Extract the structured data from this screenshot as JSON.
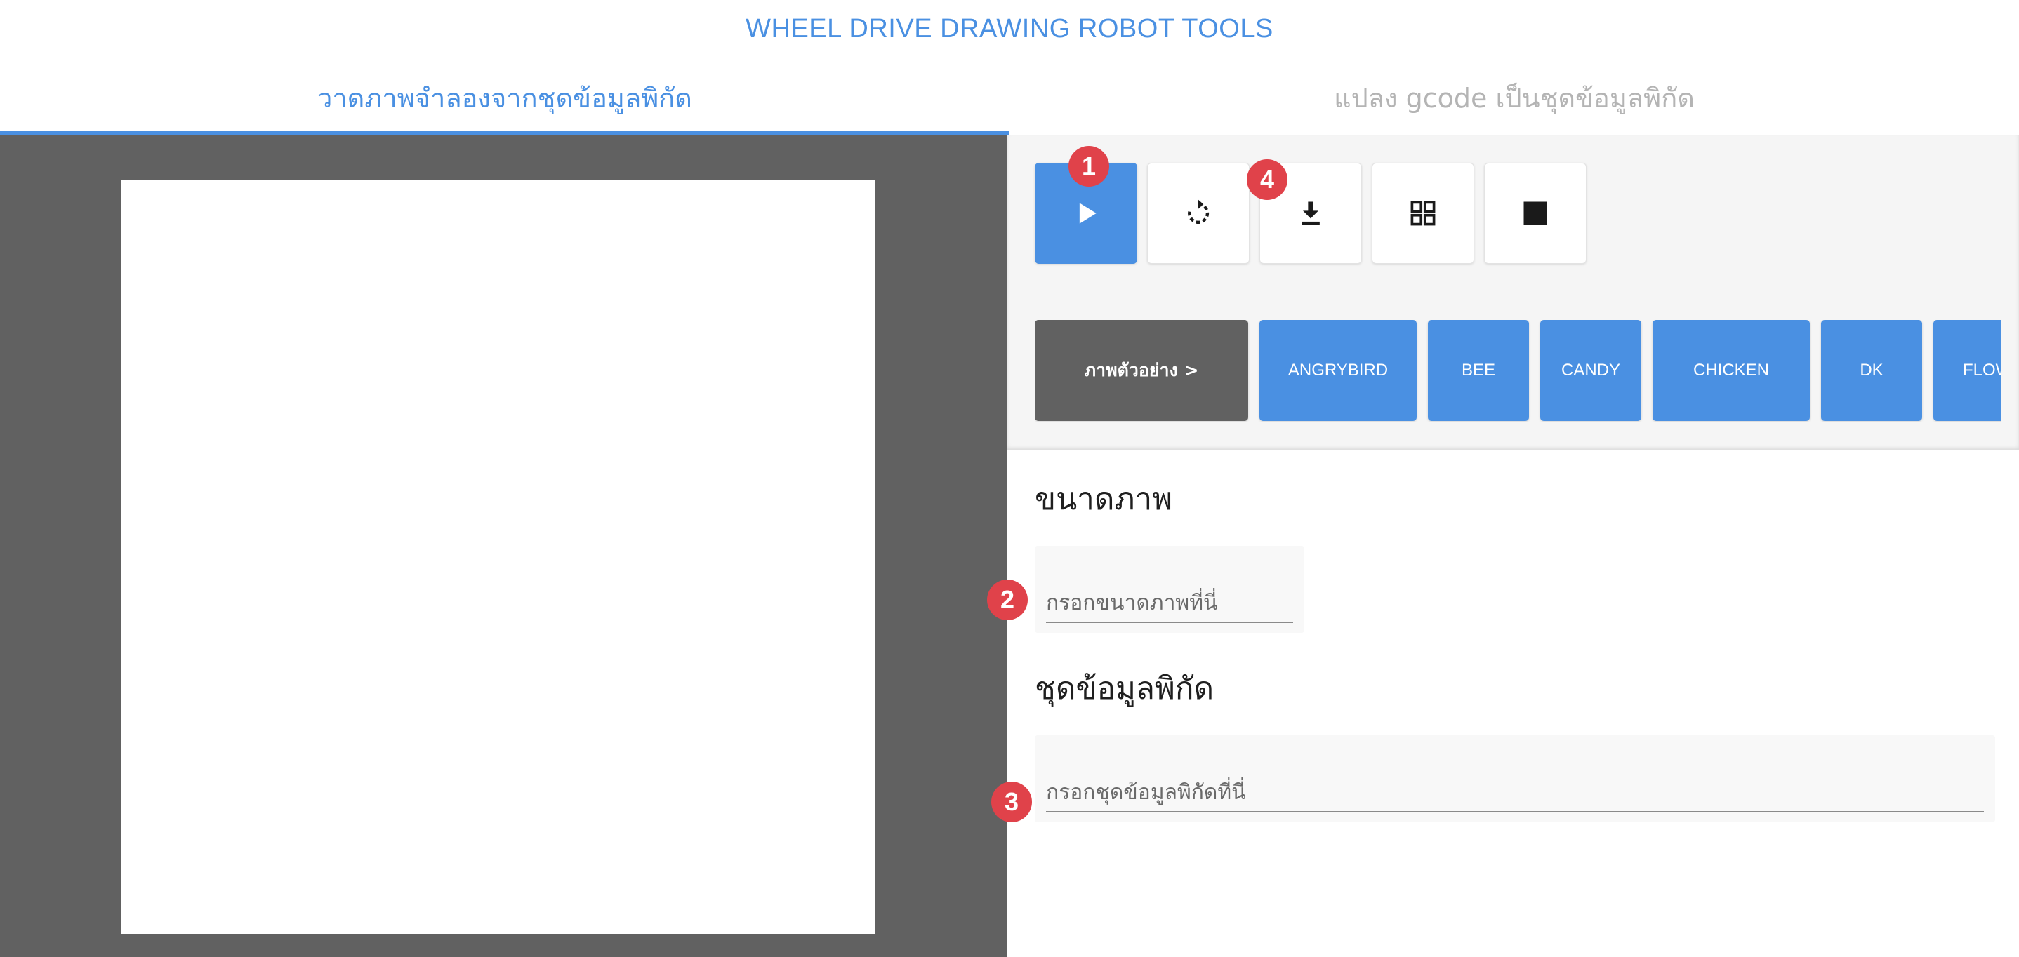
{
  "app": {
    "title": "WHEEL DRIVE DRAWING ROBOT TOOLS"
  },
  "tabs": [
    {
      "label": "วาดภาพจำลองจากชุดข้อมูลพิกัด",
      "active": true
    },
    {
      "label": "แปลง gcode เป็นชุดข้อมูลพิกัด",
      "active": false
    }
  ],
  "toolbar": {
    "buttons": [
      {
        "icon": "play-icon"
      },
      {
        "icon": "refresh-icon"
      },
      {
        "icon": "download-icon"
      },
      {
        "icon": "grid-icon"
      },
      {
        "icon": "stop-icon"
      }
    ]
  },
  "badges": {
    "b1": "1",
    "b2": "2",
    "b3": "3",
    "b4": "4"
  },
  "samples": {
    "label": "ภาพตัวอย่าง >",
    "items": [
      "ANGRYBIRD",
      "BEE",
      "CANDY",
      "CHICKEN",
      "DK",
      "FLOWER"
    ]
  },
  "size_section": {
    "title": "ขนาดภาพ",
    "placeholder": "กรอกขนาดภาพที่นี่",
    "value": ""
  },
  "coords_section": {
    "title": "ชุดข้อมูลพิกัด",
    "placeholder": "กรอกชุดข้อมูลพิกัดที่นี่",
    "value": ""
  },
  "colors": {
    "accent": "#4a90e2",
    "badge": "#e0424a",
    "canvas_bg": "#616161"
  }
}
